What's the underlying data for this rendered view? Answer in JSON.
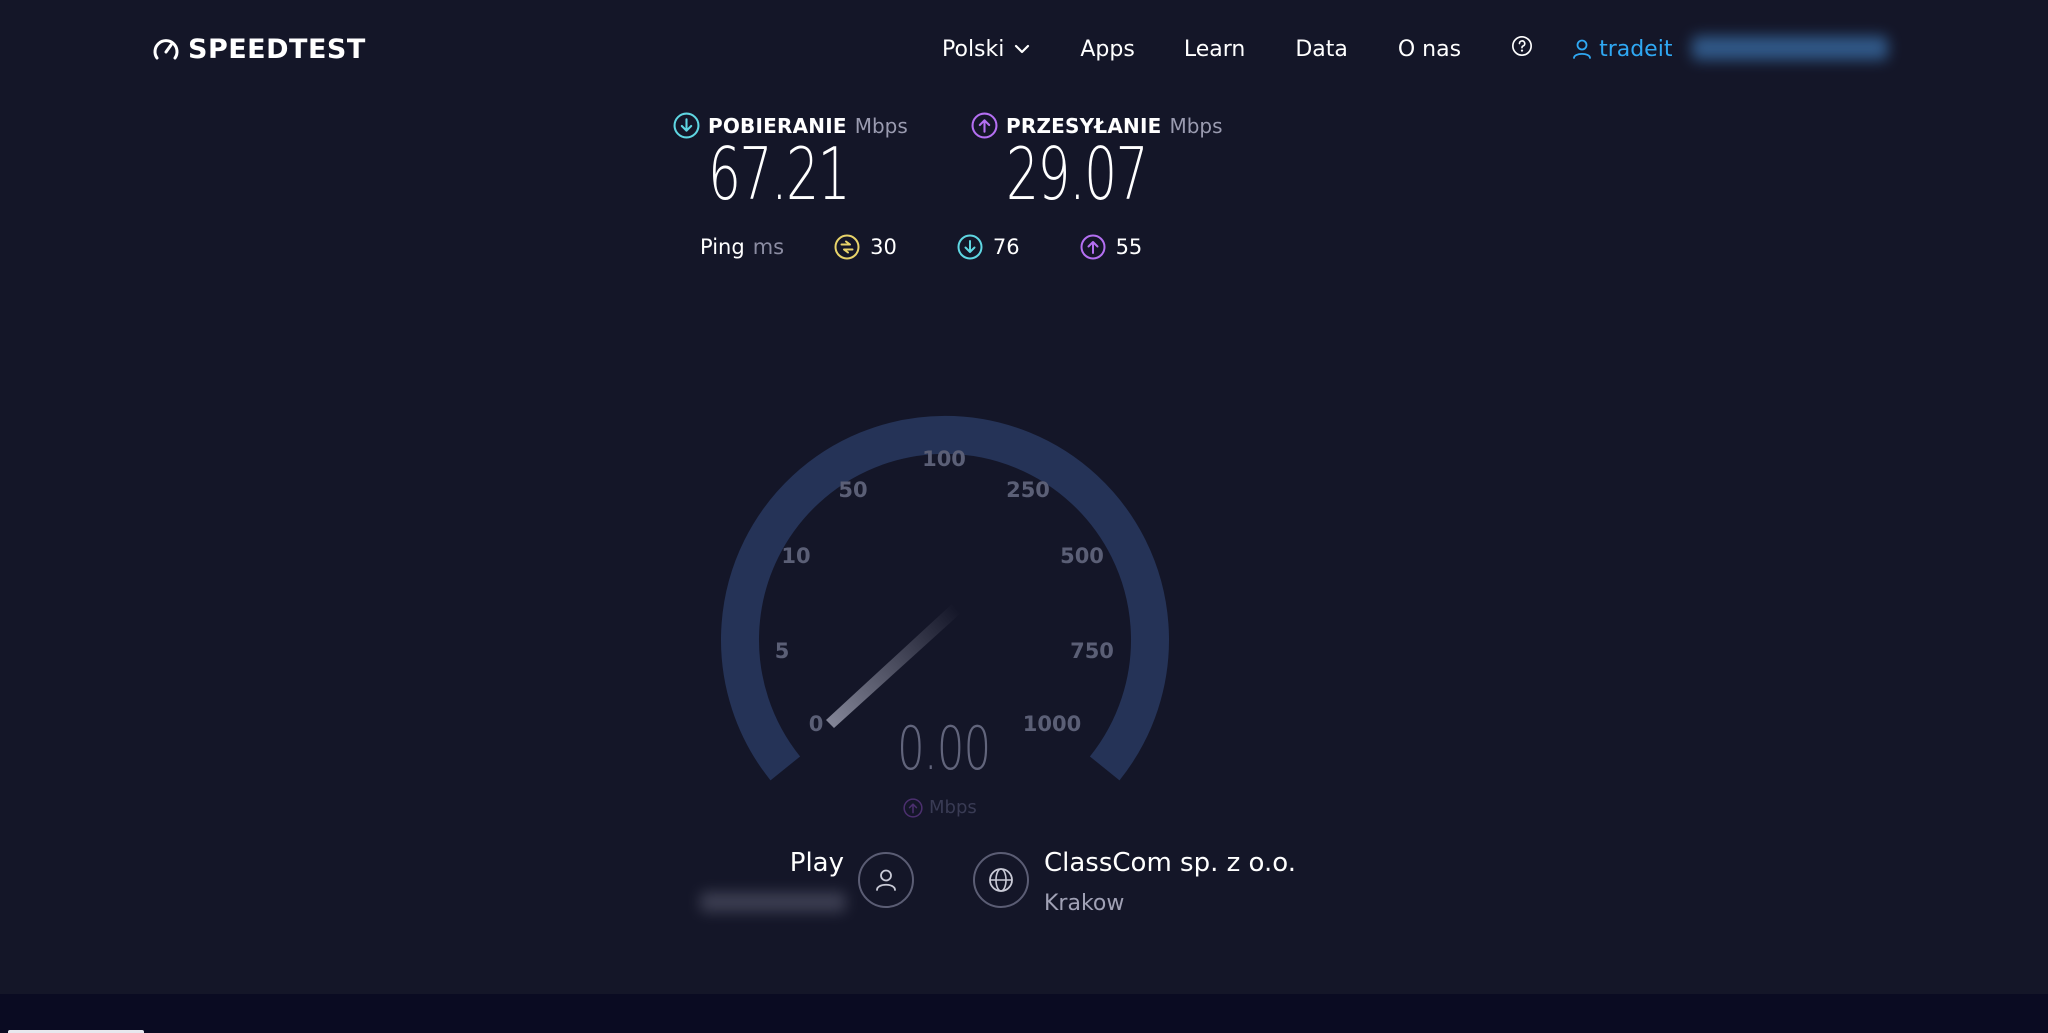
{
  "header": {
    "logo_text": "SPEEDTEST",
    "nav": {
      "language": "Polski",
      "apps": "Apps",
      "learn": "Learn",
      "data": "Data",
      "about": "O nas",
      "user": "tradeit"
    }
  },
  "results": {
    "download": {
      "label": "POBIERANIE",
      "unit": "Mbps",
      "value": "67.21"
    },
    "upload": {
      "label": "PRZESYŁANIE",
      "unit": "Mbps",
      "value": "29.07"
    },
    "ping": {
      "label": "Ping",
      "unit": "ms",
      "idle": "30",
      "download": "76",
      "upload": "55"
    }
  },
  "gauge": {
    "ticks": [
      "0",
      "5",
      "10",
      "50",
      "100",
      "250",
      "500",
      "750",
      "1000"
    ],
    "value": "0.00",
    "unit": "Mbps"
  },
  "isp": {
    "name": "Play"
  },
  "server": {
    "name": "ClassCom sp. z o.o.",
    "location": "Krakow"
  },
  "colors": {
    "background": "#141628",
    "download_accent": "#5fd6e2",
    "upload_accent": "#b46ff2",
    "ping_accent": "#e8d36a",
    "user_link": "#2fa8f3",
    "gauge_track": "#253357"
  }
}
